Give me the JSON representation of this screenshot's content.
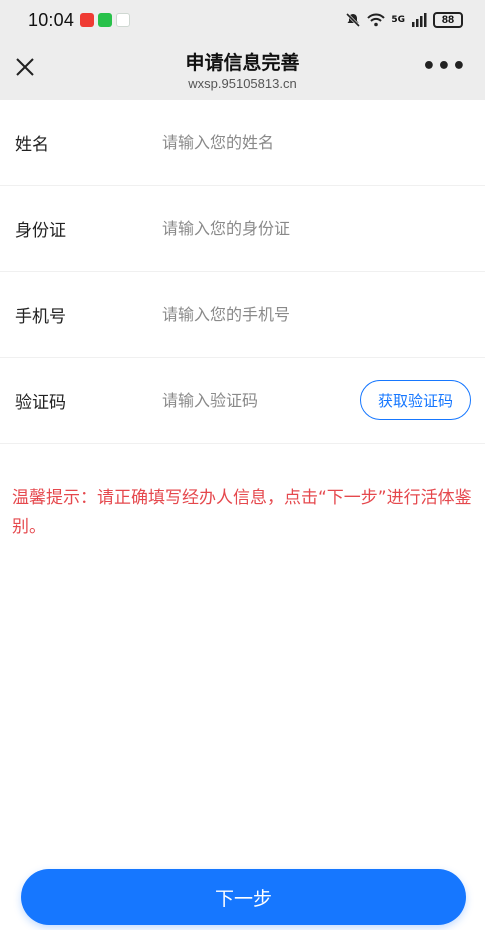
{
  "status_bar": {
    "time": "10:04",
    "network": "5G",
    "battery": "88"
  },
  "nav": {
    "title": "申请信息完善",
    "subtitle": "wxsp.95105813.cn",
    "more": "•••"
  },
  "form": {
    "fields": [
      {
        "label": "姓名",
        "placeholder": "请输入您的姓名",
        "value": ""
      },
      {
        "label": "身份证",
        "placeholder": "请输入您的身份证",
        "value": ""
      },
      {
        "label": "手机号",
        "placeholder": "请输入您的手机号",
        "value": ""
      },
      {
        "label": "验证码",
        "placeholder": "请输入验证码",
        "value": ""
      }
    ],
    "code_button": "获取验证码"
  },
  "tip": "温馨提示：请正确填写经办人信息，点击“下一步”进行活体鉴别。",
  "next_button": "下一步",
  "colors": {
    "accent": "#1677ff",
    "warning_text": "#e5484d",
    "header_bg": "#ededed"
  },
  "icons": [
    "close-icon",
    "more-icon",
    "wifi-icon",
    "signal-icon",
    "mute-icon"
  ]
}
